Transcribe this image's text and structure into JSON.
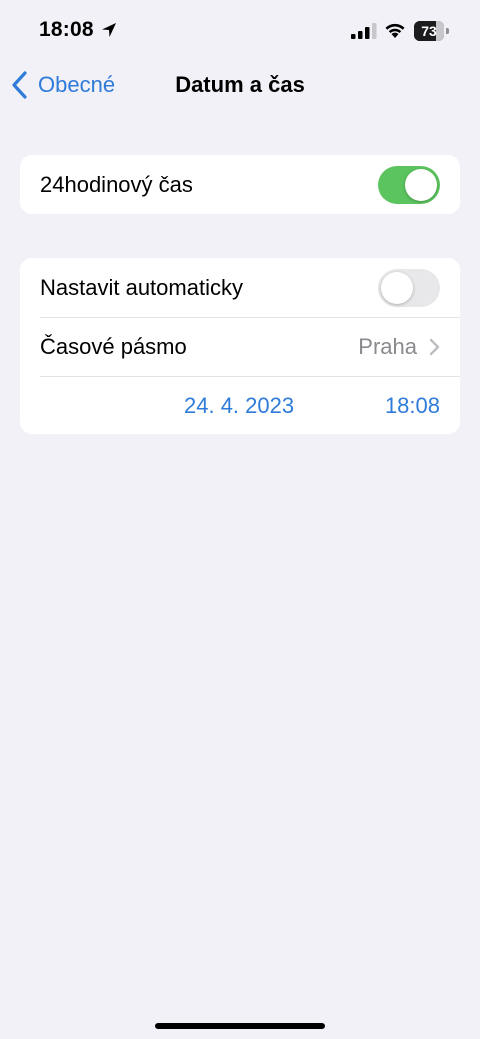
{
  "status_bar": {
    "time": "18:08",
    "battery_level": "73",
    "battery_fraction": 0.73,
    "location_icon": "location-arrow-icon",
    "signal_icon": "cellular-signal-icon",
    "wifi_icon": "wifi-icon"
  },
  "nav": {
    "back_label": "Obecné",
    "title": "Datum a čas",
    "back_icon": "chevron-left-icon"
  },
  "settings": {
    "hour24": {
      "label": "24hodinový čas",
      "enabled": true
    },
    "auto": {
      "label": "Nastavit automaticky",
      "enabled": false
    },
    "timezone": {
      "label": "Časové pásmo",
      "value": "Praha",
      "icon": "chevron-right-icon"
    },
    "datetime": {
      "date": "24. 4. 2023",
      "time": "18:08"
    }
  },
  "colors": {
    "accent": "#2f7bd9",
    "toggle_on": "#5cc45f",
    "background": "#f2f1f7"
  }
}
